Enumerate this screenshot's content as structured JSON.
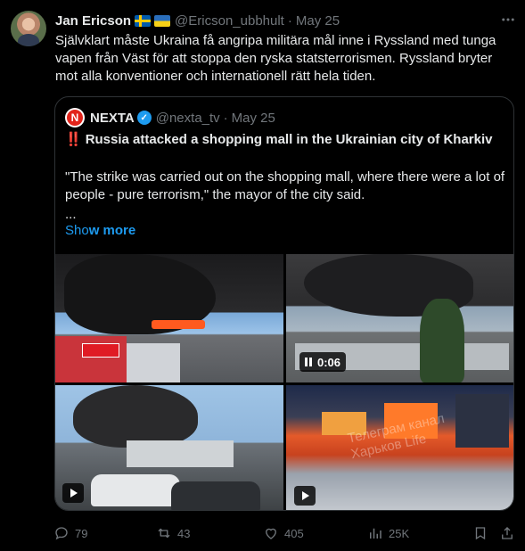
{
  "tweet": {
    "author_name": "Jan Ericson",
    "handle": "@Ericson_ubbhult",
    "separator": "·",
    "date": "May 25",
    "text": "Självklart måste Ukraina få angripa militära mål inne  i Ryssland med tunga vapen från Väst för att stoppa den ryska statsterrorismen. Ryssland bryter mot alla konventioner och internationell rätt hela tiden."
  },
  "quote": {
    "author_name": "NEXTA",
    "logo_letter": "N",
    "handle": "@nexta_tv",
    "separator": "·",
    "date": "May 25",
    "title_mark": "‼️",
    "title": "Russia attacked a shopping mall in the Ukrainian city of Kharkiv",
    "body": "\"The strike was carried out on the shopping mall, where there were a lot of people - pure terrorism,\" the mayor of the city said.",
    "ellipsis": "...",
    "show_more_prefix": "Sho",
    "show_more_suffix": "w more",
    "media": [
      {
        "type": "image"
      },
      {
        "type": "video",
        "duration": "0:06"
      },
      {
        "type": "video"
      },
      {
        "type": "video",
        "watermark": "Телеграм канал\nХарьков Life"
      }
    ]
  },
  "actions": {
    "replies": "79",
    "reposts": "43",
    "likes": "405",
    "views": "25K"
  },
  "colors": {
    "background": "#000000",
    "text": "#e7e9ea",
    "muted": "#71767b",
    "accent": "#1d9bf0",
    "border": "#2f3336"
  }
}
